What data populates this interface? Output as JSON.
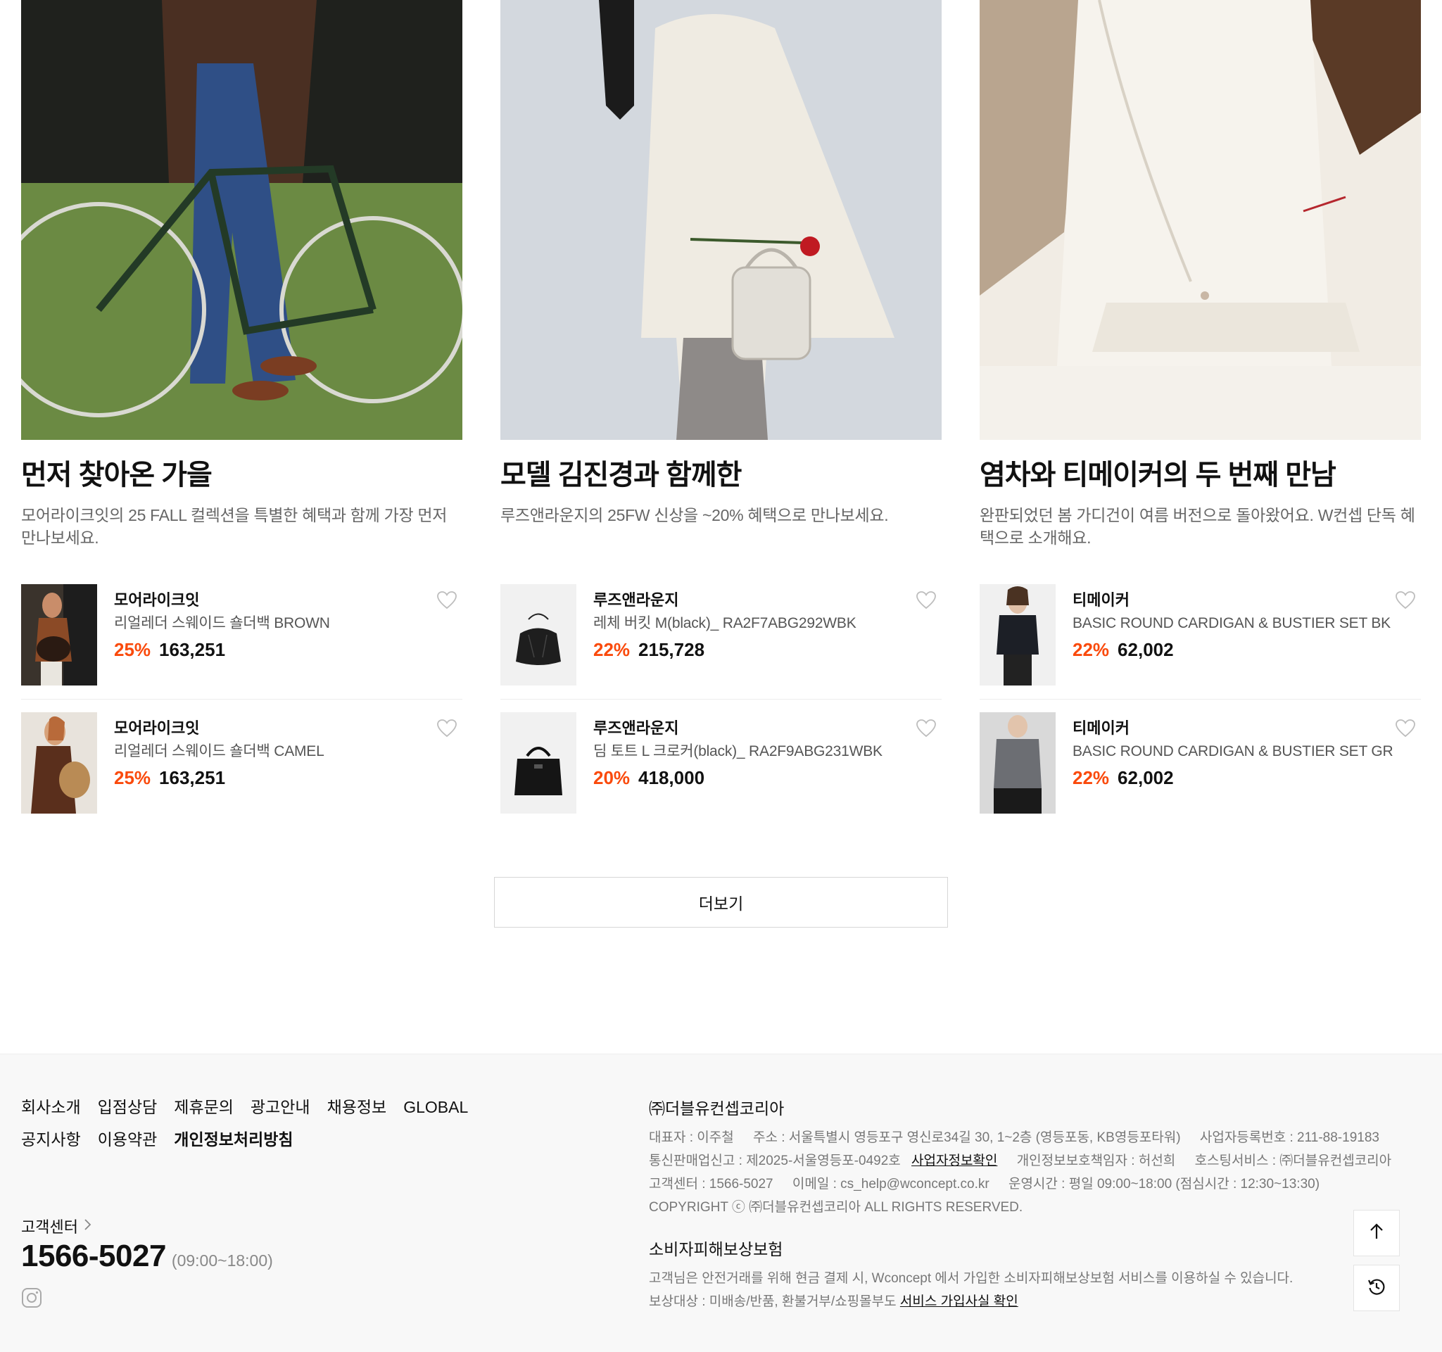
{
  "cards": [
    {
      "title": "먼저 찾아온 가을",
      "desc": "모어라이크잇의 25 FALL 컬렉션을 특별한 혜택과 함께 가장 먼저 만나보세요.",
      "products": [
        {
          "brand": "모어라이크잇",
          "name": "리얼레더 스웨이드 숄더백 BROWN",
          "discount": "25%",
          "price": "163,251"
        },
        {
          "brand": "모어라이크잇",
          "name": "리얼레더 스웨이드 숄더백 CAMEL",
          "discount": "25%",
          "price": "163,251"
        }
      ]
    },
    {
      "title": "모델 김진경과 함께한",
      "desc": "루즈앤라운지의 25FW 신상을 ~20% 혜택으로 만나보세요.",
      "products": [
        {
          "brand": "루즈앤라운지",
          "name": "레체 버킷 M(black)_ RA2F7ABG292WBK",
          "discount": "22%",
          "price": "215,728"
        },
        {
          "brand": "루즈앤라운지",
          "name": "딤 토트 L 크로커(black)_ RA2F9ABG231WBK",
          "discount": "20%",
          "price": "418,000"
        }
      ]
    },
    {
      "title": "염차와 티메이커의 두 번째 만남",
      "desc": "완판되었던 봄 가디건이 여름 버전으로 돌아왔어요. W컨셉 단독 혜택으로 소개해요.",
      "products": [
        {
          "brand": "티메이커",
          "name": "BASIC ROUND CARDIGAN & BUSTIER SET BK",
          "discount": "22%",
          "price": "62,002"
        },
        {
          "brand": "티메이커",
          "name": "BASIC ROUND CARDIGAN & BUSTIER SET GR",
          "discount": "22%",
          "price": "62,002"
        }
      ]
    }
  ],
  "more_button": "더보기",
  "footer": {
    "links_row1": [
      "회사소개",
      "입점상담",
      "제휴문의",
      "광고안내",
      "채용정보",
      "GLOBAL"
    ],
    "links_row2": [
      "공지사항",
      "이용약관",
      "개인정보처리방침"
    ],
    "cs_label": "고객센터",
    "cs_phone": "1566-5027",
    "cs_hours": "(09:00~18:00)",
    "company_name": "㈜더블유컨셉코리아",
    "ceo": "대표자 : 이주철",
    "address": "주소 : 서울특별시 영등포구 영신로34길 30, 1~2층 (영등포동, KB영등포타워)",
    "biz_no": "사업자등록번호 : 211-88-19183",
    "mail_order": "통신판매업신고 : 제2025-서울영등포-0492호",
    "biz_info_link": "사업자정보확인",
    "privacy_officer": "개인정보보호책임자 : 허선희",
    "hosting": "호스팅서비스 : ㈜더블유컨셉코리아",
    "cs_center": "고객센터 : 1566-5027",
    "email": "이메일 : cs_help@wconcept.co.kr",
    "hours": "운영시간 : 평일 09:00~18:00 (점심시간 : 12:30~13:30)",
    "copyright": "COPYRIGHT ⓒ ㈜더블유컨셉코리아 ALL RIGHTS RESERVED.",
    "insure_title": "소비자피해보상보험",
    "insure_desc": "고객님은 안전거래를 위해 현금 결제 시, Wconcept 에서 가입한 소비자피해보상보험 서비스를 이용하실 수 있습니다.",
    "insure_target": "보상대상 : 미배송/반품, 환불거부/쇼핑몰부도",
    "insure_link": "서비스 가입사실 확인"
  },
  "colors": {
    "discount": "#fa4a0c",
    "footer_bg": "#f8f8f8"
  },
  "icons": [
    "heart-icon",
    "chevron-right-icon",
    "instagram-icon",
    "arrow-up-icon",
    "history-icon"
  ]
}
